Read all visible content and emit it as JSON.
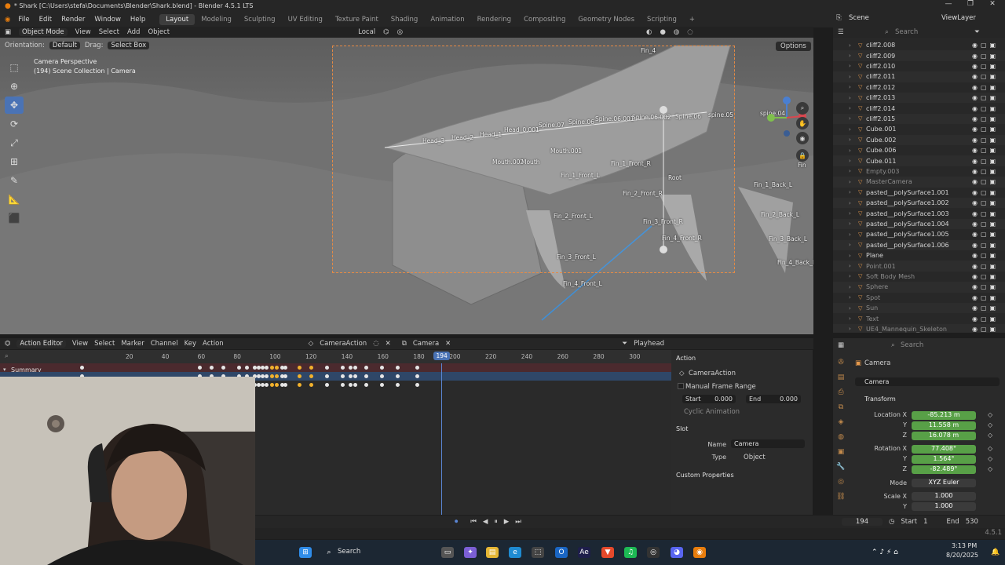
{
  "window": {
    "title": "* Shark [C:\\Users\\stefa\\Documents\\Blender\\Shark.blend] - Blender 4.5.1 LTS"
  },
  "menubar": {
    "menus": [
      "File",
      "Edit",
      "Render",
      "Window",
      "Help"
    ],
    "workspaces": [
      "Layout",
      "Modeling",
      "Sculpting",
      "UV Editing",
      "Texture Paint",
      "Shading",
      "Animation",
      "Rendering",
      "Compositing",
      "Geometry Nodes",
      "Scripting"
    ],
    "active_workspace": "Layout",
    "add_tab": "+",
    "scene": "Scene",
    "view_layer": "ViewLayer"
  },
  "viewport": {
    "mode": "Object Mode",
    "menus": [
      "View",
      "Select",
      "Add",
      "Object"
    ],
    "pivot": "Local",
    "orientation_label": "Orientation:",
    "orientation_value": "Default",
    "drag_label": "Drag:",
    "drag_value": "Select Box",
    "options": "Options",
    "camera_title": "Camera Perspective",
    "camera_subtitle": "(194) Scene Collection | Camera",
    "bone_labels": [
      "Fin_4",
      "Head_3",
      "Head_2",
      "Head_1",
      "Head_0.001",
      "Spine.07",
      "Spine.06",
      "Spine.06.001",
      "Spine.06.002",
      "Spine.06",
      "spine.05",
      "spine.04",
      "Mouth.001",
      "Mouth.002",
      "Mouth",
      "Fin_1_Front_L",
      "Fin_1_Front_R",
      "Root",
      "Fin_2_Front_R",
      "Fin_2_Front_L",
      "Fin_3_Front_R",
      "Fin_4_Front_R",
      "Fin_3_Front_L",
      "Fin_4_Front_L",
      "Fin_1_Back_L",
      "Fin_2_Back_L",
      "Fin_3_Back_L",
      "Fin_4_Back_L",
      "Fin"
    ]
  },
  "outliner": {
    "search_placeholder": "Search",
    "items": [
      {
        "name": "cliff2.008",
        "faded": false
      },
      {
        "name": "cliff2.009",
        "faded": false
      },
      {
        "name": "cliff2.010",
        "faded": false
      },
      {
        "name": "cliff2.011",
        "faded": false
      },
      {
        "name": "cliff2.012",
        "faded": false
      },
      {
        "name": "cliff2.013",
        "faded": false
      },
      {
        "name": "cliff2.014",
        "faded": false
      },
      {
        "name": "cliff2.015",
        "faded": false
      },
      {
        "name": "Cube.001",
        "faded": false
      },
      {
        "name": "Cube.002",
        "faded": false
      },
      {
        "name": "Cube.006",
        "faded": false
      },
      {
        "name": "Cube.011",
        "faded": false
      },
      {
        "name": "Empty.003",
        "faded": true
      },
      {
        "name": "MasterCamera",
        "faded": true
      },
      {
        "name": "pasted__polySurface1.001",
        "faded": false
      },
      {
        "name": "pasted__polySurface1.002",
        "faded": false
      },
      {
        "name": "pasted__polySurface1.003",
        "faded": false
      },
      {
        "name": "pasted__polySurface1.004",
        "faded": false
      },
      {
        "name": "pasted__polySurface1.005",
        "faded": false
      },
      {
        "name": "pasted__polySurface1.006",
        "faded": false
      },
      {
        "name": "Plane",
        "faded": false
      },
      {
        "name": "Point.001",
        "faded": true
      },
      {
        "name": "Soft Body Mesh",
        "faded": true
      },
      {
        "name": "Sphere",
        "faded": true
      },
      {
        "name": "Spot",
        "faded": true
      },
      {
        "name": "Sun",
        "faded": true
      },
      {
        "name": "Text",
        "faded": true
      },
      {
        "name": "UE4_Mannequin_Skeleton",
        "faded": true
      }
    ]
  },
  "action_editor": {
    "mode": "Action Editor",
    "menus": [
      "View",
      "Select",
      "Marker",
      "Channel",
      "Key",
      "Action"
    ],
    "action_name": "CameraAction",
    "slot_name": "Camera",
    "playhead_label": "Playhead",
    "search_placeholder": "",
    "summary": "Summary",
    "current_frame": "194",
    "ruler_ticks": [
      "20",
      "40",
      "60",
      "80",
      "100",
      "120",
      "140",
      "160",
      "180",
      "200",
      "220",
      "240",
      "260",
      "280",
      "300"
    ],
    "keyframes": [
      10,
      160,
      175,
      190,
      210,
      220,
      230,
      235,
      240,
      245,
      252,
      258,
      265,
      269,
      287,
      302,
      322,
      342,
      352,
      358,
      372,
      392,
      412,
      437
    ],
    "selected_keyframes": [
      252,
      258,
      287,
      302
    ],
    "panel": {
      "action_section": "Action",
      "action_value": "CameraAction",
      "manual_range": "Manual Frame Range",
      "start_label": "Start",
      "start_value": "0.000",
      "end_label": "End",
      "end_value": "0.000",
      "cyclic": "Cyclic Animation",
      "slot_section": "Slot",
      "name_label": "Name",
      "name_value": "Camera",
      "type_label": "Type",
      "type_value": "Object",
      "custom_props": "Custom Properties"
    }
  },
  "properties": {
    "search_placeholder": "Search",
    "object_name": "Camera",
    "object_data": "Camera",
    "transform_section": "Transform",
    "location_label": "Location X",
    "location": [
      "-85.213 m",
      "11.558 m",
      "16.078 m"
    ],
    "rotation_label": "Rotation X",
    "rotation": [
      "77.408°",
      "1.564°",
      "-82.489°"
    ],
    "mode_label": "Mode",
    "mode_value": "XYZ Euler",
    "scale_label": "Scale X",
    "scale": [
      "1.000",
      "1.000"
    ],
    "axis_y": "Y",
    "axis_z": "Z"
  },
  "timeline": {
    "current_frame": "194",
    "start_label": "Start",
    "start_value": "1",
    "end_label": "End",
    "end_value": "530",
    "version": "4.5.1"
  },
  "taskbar": {
    "search": "Search",
    "time": "3:13 PM",
    "date": "8/20/2025"
  },
  "colors": {
    "accent_blue": "#4a73b5",
    "field_green": "#58a047",
    "camera_frame": "#e58a44",
    "keyframe_selected": "#f2b12c",
    "object_icon": "#e79a4c"
  }
}
